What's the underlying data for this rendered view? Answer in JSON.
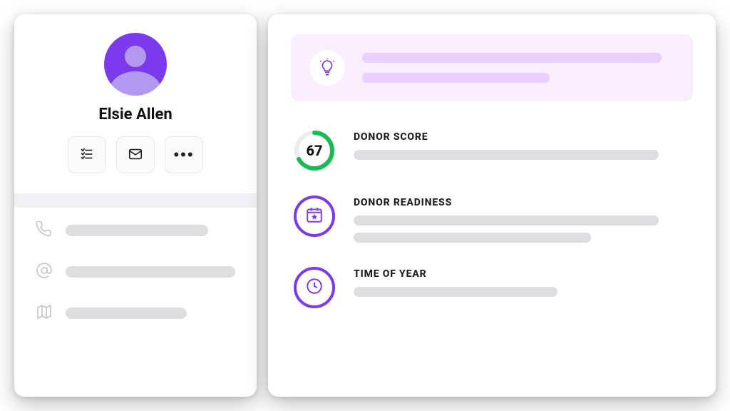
{
  "colors": {
    "accent": "#7c3aed",
    "score_ring": "#1db954",
    "placeholder": "#dedee1",
    "banner_bg": "#f8eeff",
    "banner_placeholder": "#e9cffb"
  },
  "profile": {
    "name": "Elsie Allen",
    "action_buttons": {
      "list": "list-icon",
      "mail": "mail-icon",
      "more": "more-icon"
    },
    "contact_rows": [
      {
        "icon": "phone-icon"
      },
      {
        "icon": "at-icon"
      },
      {
        "icon": "map-icon"
      }
    ]
  },
  "insight_banner": {
    "icon": "lightbulb-icon"
  },
  "metrics": [
    {
      "key": "donor_score",
      "label": "DONOR SCORE",
      "value": 67,
      "kind": "progress-arc"
    },
    {
      "key": "donor_readiness",
      "label": "DONOR READINESS",
      "icon": "calendar-star-icon",
      "kind": "icon-ring"
    },
    {
      "key": "time_of_year",
      "label": "TIME OF YEAR",
      "icon": "clock-icon",
      "kind": "icon-ring"
    }
  ]
}
